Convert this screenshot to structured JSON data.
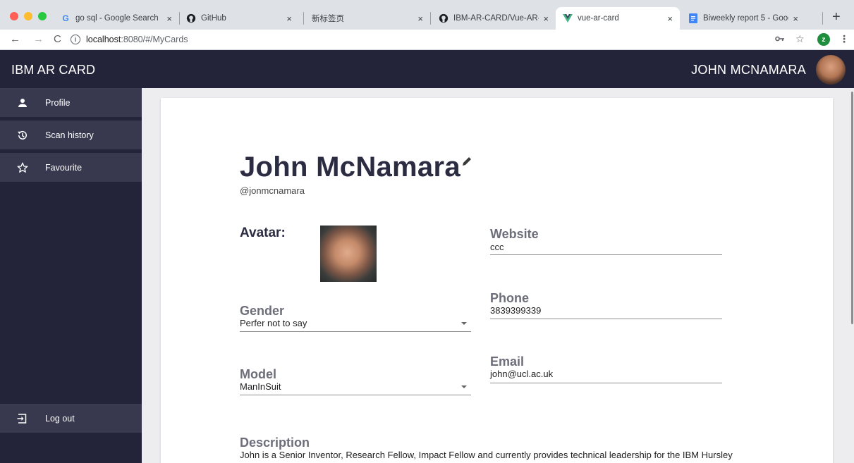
{
  "browser": {
    "tabs": [
      {
        "title": "go sql - Google Search",
        "icon": "google-icon",
        "active": false
      },
      {
        "title": "GitHub",
        "icon": "github-icon",
        "active": false
      },
      {
        "title": "新标签页",
        "icon": "none",
        "active": false
      },
      {
        "title": "IBM-AR-CARD/Vue-AR-Car",
        "icon": "github-icon",
        "active": false
      },
      {
        "title": "vue-ar-card",
        "icon": "vue-icon",
        "active": true
      },
      {
        "title": "Biweekly report 5 - Google",
        "icon": "docs-icon",
        "active": false
      }
    ],
    "close_glyph": "×",
    "new_tab_glyph": "+",
    "url_host": "localhost",
    "url_rest": ":8080/#/MyCards",
    "profile_initial": "z"
  },
  "app": {
    "title": "IBM AR CARD",
    "user_name": "JOHN MCNAMARA"
  },
  "sidebar": {
    "items": [
      {
        "label": "Profile",
        "icon": "person-icon"
      },
      {
        "label": "Scan history",
        "icon": "history-icon"
      },
      {
        "label": "Favourite",
        "icon": "star-icon"
      }
    ],
    "logout": {
      "label": "Log out",
      "icon": "logout-icon"
    }
  },
  "profile": {
    "name": "John McNamara",
    "handle": "@jonmcnamara",
    "avatar_label": "Avatar:",
    "gender": {
      "label": "Gender",
      "value": "Perfer not to say"
    },
    "model": {
      "label": "Model",
      "value": "ManInSuit"
    },
    "website": {
      "label": "Website",
      "value": "ccc"
    },
    "phone": {
      "label": "Phone",
      "value": "3839399339"
    },
    "email": {
      "label": "Email",
      "value": "john@ucl.ac.uk"
    },
    "description": {
      "label": "Description",
      "value": "John is a Senior Inventor, Research Fellow, Impact Fellow and currently provides technical leadership for the IBM Hursley"
    }
  },
  "colors": {
    "header_bg": "#23243a",
    "sidebar_item_bg": "#38394f",
    "title_text": "#2b2c42"
  }
}
